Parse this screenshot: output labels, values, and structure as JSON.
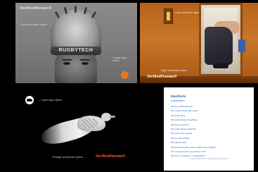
{
  "panels": {
    "top_left": {
      "brand": "VerifiedHuman®",
      "caption": "Core wordmark option",
      "helmet_text": "RUGBYTECH",
      "side_caption": "Orange logo option"
    },
    "top_right": {
      "small_caption": "Light wordmark option",
      "caption": "Light wordmark option",
      "brand": "VerifiedHuman®"
    },
    "bottom_left": {
      "logo_caption": "Light logo option",
      "caption": "Orange wordmark option",
      "brand": "VerifiedHuman®"
    },
    "bottom_right": {
      "title": "Manifesto",
      "subtitle": "A declaration",
      "lines": [
        "We are VerifiedHuman.",
        "We create things that matter.",
        "We think freely.",
        "We build things thoughtfully.",
        "We keep promises.",
        "We make things authentic.",
        "We care about people.",
        "We are real people.",
        "We stay curious.",
        "We bring humanity, value, quality, and integrity.",
        "We choose human, we choose truth.",
        "We are in it together, not algorithms."
      ],
      "foot": "Logo option for light backgrounds"
    }
  },
  "colors": {
    "accent_orange": "#ff5a1f",
    "text_blue": "#2f5db5",
    "caption_blue": "#b8c8e8"
  }
}
